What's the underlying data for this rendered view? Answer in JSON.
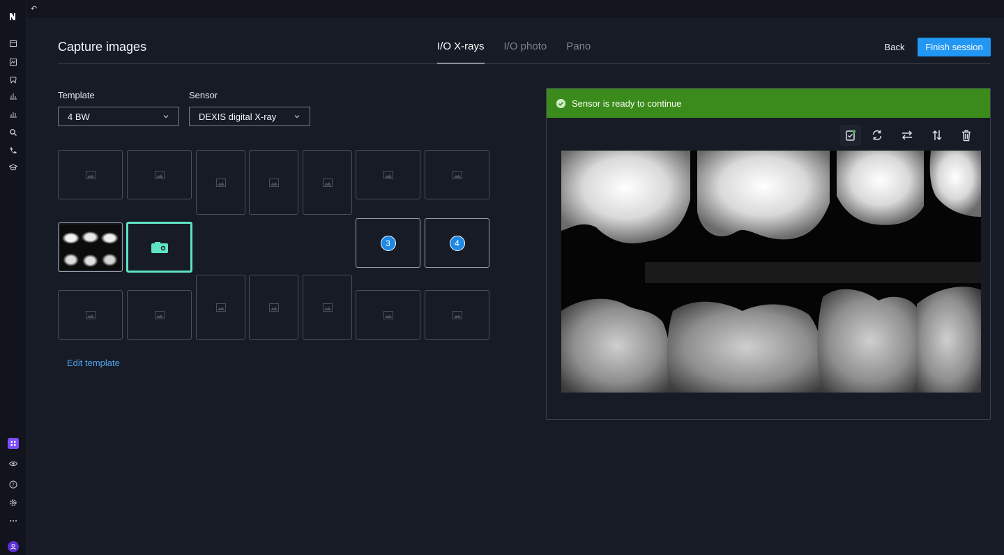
{
  "app": {
    "rail_icons": [
      "logo-icon",
      "calendar-icon",
      "chart-icon",
      "tooth-icon",
      "bar-chart-icon",
      "bar-chart-icon",
      "search-icon",
      "phone-icon",
      "graduation-cap-icon",
      "apps-icon",
      "eye-icon",
      "help-icon",
      "gear-icon",
      "more-icon",
      "user-icon"
    ]
  },
  "header": {
    "title": "Capture images",
    "tabs": [
      {
        "label": "I/O X-rays",
        "active": true
      },
      {
        "label": "I/O photo",
        "active": false
      },
      {
        "label": "Pano",
        "active": false
      }
    ],
    "back_label": "Back",
    "finish_label": "Finish session"
  },
  "form": {
    "template_label": "Template",
    "template_value": "4 BW",
    "sensor_label": "Sensor",
    "sensor_value": "DEXIS digital X-ray"
  },
  "grid": {
    "slot_numbers": [
      "3",
      "4"
    ],
    "edit_template_label": "Edit template"
  },
  "viewer": {
    "status_text": "Sensor is ready to continue",
    "status_color": "#3b8a1c",
    "tools": [
      "approve-icon",
      "rotate-icon",
      "swap-horizontal-icon",
      "swap-vertical-icon",
      "trash-icon"
    ]
  },
  "colors": {
    "accent": "#2196f3",
    "active_slot": "#5fe3c1",
    "background": "#171b26"
  }
}
